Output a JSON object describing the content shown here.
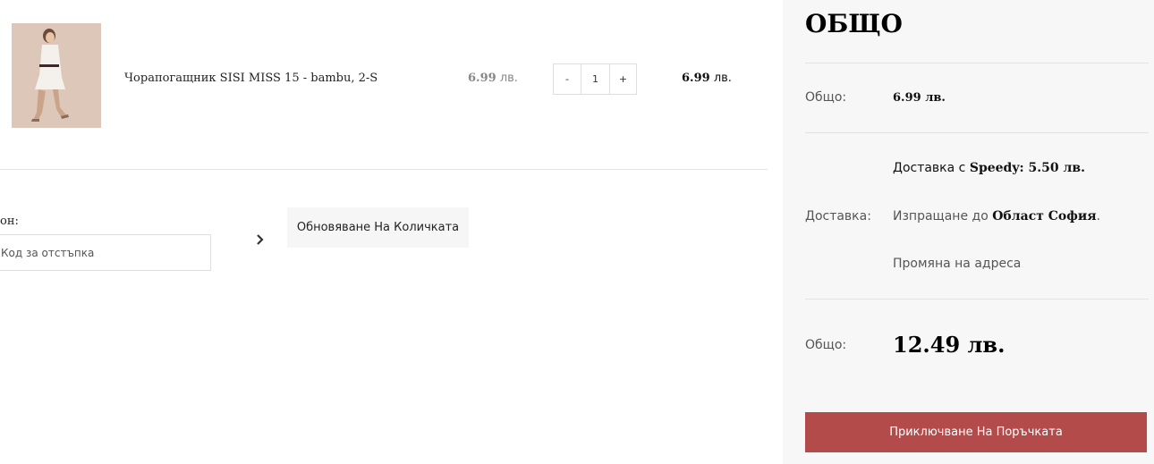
{
  "cart": {
    "item": {
      "image_alt": "product-photo",
      "name": "Чорапогащник SISI MISS 15 - bambu, 2-S",
      "unit_price_value": "6.99",
      "unit_price_currency": "лв.",
      "qty_minus": "-",
      "qty_value": "1",
      "qty_plus": "+",
      "total_value": "6.99",
      "total_currency": "лв."
    },
    "coupon": {
      "label": "он:",
      "placeholder": "Код за отстъпка"
    },
    "update_button": "Обновяване На Количката"
  },
  "summary": {
    "title": "ОБЩО",
    "subtotal_label": "Общо:",
    "subtotal_value": "6.99 лв.",
    "shipping_label": "Доставка:",
    "shipping_method_prefix": "Доставка с ",
    "shipping_method_name": "Speedy:",
    "shipping_method_price": " 5.50 лв.",
    "ship_to_prefix": "Изпращане до ",
    "ship_to_region": "Област София",
    "ship_to_suffix": ".",
    "change_address": "Промяна на адреса",
    "total_label": "Общо:",
    "total_value": "12.49 лв.",
    "checkout_button": "Приключване На Поръчката"
  },
  "colors": {
    "accent": "#b34b4b",
    "summary_bg": "#f7f7f7",
    "muted_price": "#888888"
  },
  "icons": {
    "apply": "chevron-right-icon"
  }
}
